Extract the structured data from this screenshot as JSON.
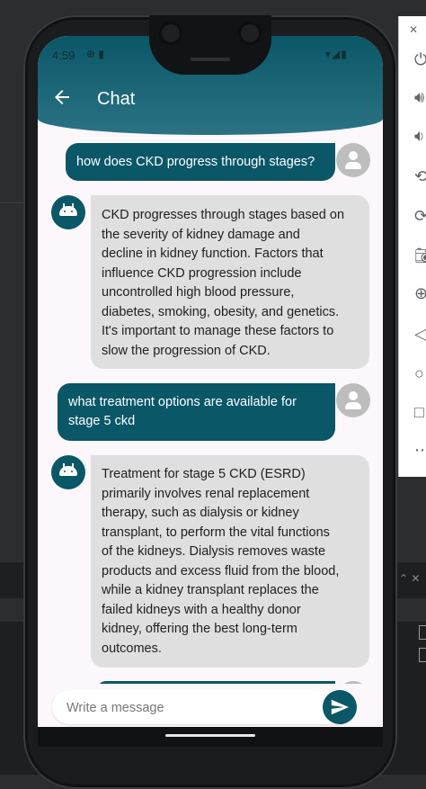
{
  "status_bar": {
    "time": "4:59"
  },
  "header": {
    "title": "Chat"
  },
  "messages": [
    {
      "sender": "user",
      "lines": [
        "how does CKD progress through stages?"
      ]
    },
    {
      "sender": "bot",
      "lines": [
        "CKD progresses through stages based on",
        "the severity of kidney damage and",
        "decline in kidney function. Factors that",
        "influence CKD progression include",
        "uncontrolled high blood pressure,",
        "diabetes, smoking, obesity, and genetics.",
        "It's important to manage these factors to",
        "slow the progression of CKD."
      ]
    },
    {
      "sender": "user",
      "lines": [
        "what treatment options are available for",
        "stage 5 ckd"
      ]
    },
    {
      "sender": "bot",
      "lines": [
        "Treatment for stage 5 CKD (ESRD)",
        "primarily involves renal replacement",
        "therapy, such as dialysis or kidney",
        "transplant, to perform the vital functions",
        "of the kidneys. Dialysis removes waste",
        "products and excess fluid from the blood,",
        "while a kidney transplant replaces the",
        "failed kidneys with a healthy donor",
        "kidney, offering the best long-term",
        "outcomes."
      ]
    }
  ],
  "input": {
    "placeholder": "Write a message"
  },
  "colors": {
    "primary": "#0a5768",
    "bot_bubble": "#dfdfdf",
    "background": "#fbf7fb"
  },
  "icons": [
    "back-arrow-icon",
    "user-avatar-icon",
    "android-bot-icon",
    "send-icon"
  ]
}
